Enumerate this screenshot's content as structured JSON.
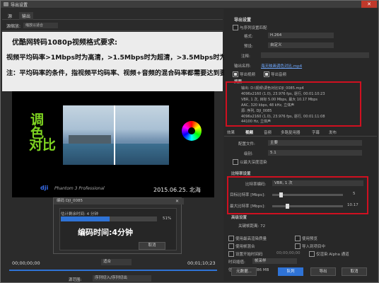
{
  "window": {
    "title": "导出设置",
    "close": "✕"
  },
  "left_tabs": [
    "源",
    "输出"
  ],
  "source": {
    "label": "源缩放:",
    "value": "缩放以适合"
  },
  "description_lines": [
    "优酷网转码1080p视频格式要求:",
    "视频平均码率>1Mbps时为高清，>1.5Mbps时为超清，>3.5Mbps时为1080p.",
    "注：平均码率的条件，指视频平均码率、视频+音频的混合码率都需要达到要求。"
  ],
  "video": {
    "title_vertical": "调色",
    "title_line2": "对比",
    "dji_logo": "dji",
    "phantom": "Phantom 3 Professional",
    "date": "2015.06.25. 北海"
  },
  "encode_dialog": {
    "title": "编码 DJI_0085",
    "close": "✕",
    "remaining": "估计剩余时间: 4 分钟",
    "percent": "51%",
    "progress": 0.51,
    "encode_time": "编码时间:4分钟",
    "cancel": "取消"
  },
  "timeline": {
    "start_tc": "00;00;00;00",
    "end_tc": "00;01;10;23",
    "fit": "适合",
    "source_range_label": "源范围:",
    "source_range_value": "序列切入/序列切出"
  },
  "export_settings": {
    "header": "导出设置",
    "match_sequence": "与序列设置匹配",
    "format_label": "格式:",
    "format_value": "H.264",
    "preset_label": "预设:",
    "preset_value": "自定义",
    "comments_label": "注释:",
    "output_name_label": "输出名称:",
    "output_name_value": "海天映画调色对比.mp4",
    "export_video": "导出视频",
    "export_audio": "导出音频",
    "summary_header": "摘要",
    "summary_lines": [
      "输出: D:\\视频\\调色对比\\DJI_0085.mp4",
      "4096x2160 (1.0), 23.976 fps, 逐行, 00:01:10:23",
      "VBR, 1 次, 目标 5.00 Mbps, 最大 10.17 Mbps",
      "AAC, 320 kbps, 48 kHz, 立体声",
      "源: 序列, DJI_0085",
      "4096x2160 (1.0), 23.976 fps, 逐行, 00:01:11:08",
      "44100 Hz, 立体声"
    ]
  },
  "right_tabs": [
    "效果",
    "视频",
    "音频",
    "多路复用器",
    "字幕",
    "发布"
  ],
  "video_settings": {
    "profile_label": "配置文件:",
    "profile_value": "主要",
    "level_label": "级别:",
    "level_value": "5.1",
    "max_depth": "以最大深度渲染"
  },
  "bitrate": {
    "header": "比特率设置",
    "encoding_label": "比特率编码:",
    "encoding_value": "VBR, 1 次",
    "target_label": "目标比特率 [Mbps]:",
    "target_value": "5",
    "target_fraction": 0.1,
    "max_label": "最大比特率 [Mbps]:",
    "max_value": "10.17",
    "max_fraction": 0.2
  },
  "advanced": {
    "header": "高级设置",
    "keyframe": "关键帧距离: 72"
  },
  "bottom_opts": {
    "max_quality": "使用最高渲染质量",
    "use_preview": "使用预览",
    "use_proxy": "使用帧混合",
    "import_project": "导入到项目中",
    "set_start_tc": "设置开始时间码",
    "start_tc": "00;00;00;00",
    "alpha_only": "仅渲染 Alpha 通道",
    "time_interp_label": "时间插值:",
    "time_interp_value": "帧采样",
    "file_size": "估计文件大小: 386 MB"
  },
  "buttons": {
    "metadata": "元数据...",
    "queue": "队列",
    "export": "导出",
    "cancel": "取消"
  }
}
